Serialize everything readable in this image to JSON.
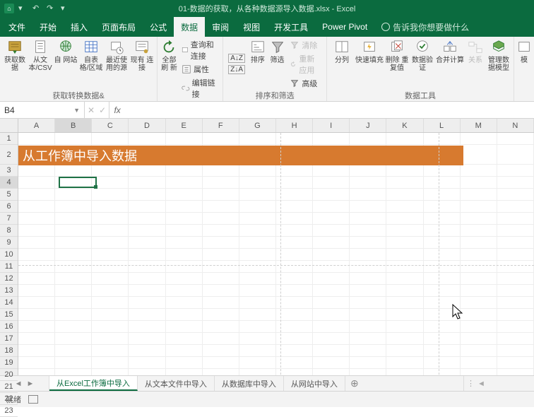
{
  "titlebar": {
    "doc_title": "01-数据的获取，从各种数据源导入数据.xlsx - Excel"
  },
  "menu": {
    "tabs": [
      "文件",
      "开始",
      "插入",
      "页面布局",
      "公式",
      "数据",
      "审阅",
      "视图",
      "开发工具",
      "Power Pivot"
    ],
    "active_index": 5,
    "tell_me": "告诉我你想要做什么"
  },
  "ribbon": {
    "g1": {
      "label": "获取转换数据&",
      "b0": "获取数\n据",
      "b1": "从文\n本/CSV",
      "b2": "自\n网站",
      "b3": "自表\n格/区域",
      "b4": "最近使\n用的源",
      "b5": "现有\n连接"
    },
    "g2": {
      "label": "查询和连接",
      "big": "全部刷\n新",
      "s0": "查询和连接",
      "s1": "属性",
      "s2": "编辑链接"
    },
    "g3": {
      "label": "排序和筛选",
      "sortAZ": "A↓Z",
      "sortZA": "Z↓A",
      "sort": "排序",
      "filter": "筛选",
      "s0": "清除",
      "s1": "重新应用",
      "s2": "高级"
    },
    "g4": {
      "label": "数据工具",
      "b0": "分列",
      "b1": "快速填充",
      "b2": "删除\n重复值",
      "b3": "数据验\n证",
      "b4": "合并计算",
      "b5": "关系",
      "b6": "管理数\n据模型"
    },
    "g5": {
      "b0": "模"
    }
  },
  "namebox": {
    "ref": "B4"
  },
  "columns": [
    "A",
    "B",
    "C",
    "D",
    "E",
    "F",
    "G",
    "H",
    "I",
    "J",
    "K",
    "L",
    "M",
    "N"
  ],
  "rows_count": 23,
  "banner_text": "从工作簿中导入数据",
  "selected": {
    "col": "B",
    "row": 4
  },
  "sheets": {
    "tabs": [
      "从Excel工作簿中导入",
      "从文本文件中导入",
      "从数据库中导入",
      "从网站中导入"
    ],
    "active_index": 0
  },
  "status": {
    "text": "就绪"
  }
}
